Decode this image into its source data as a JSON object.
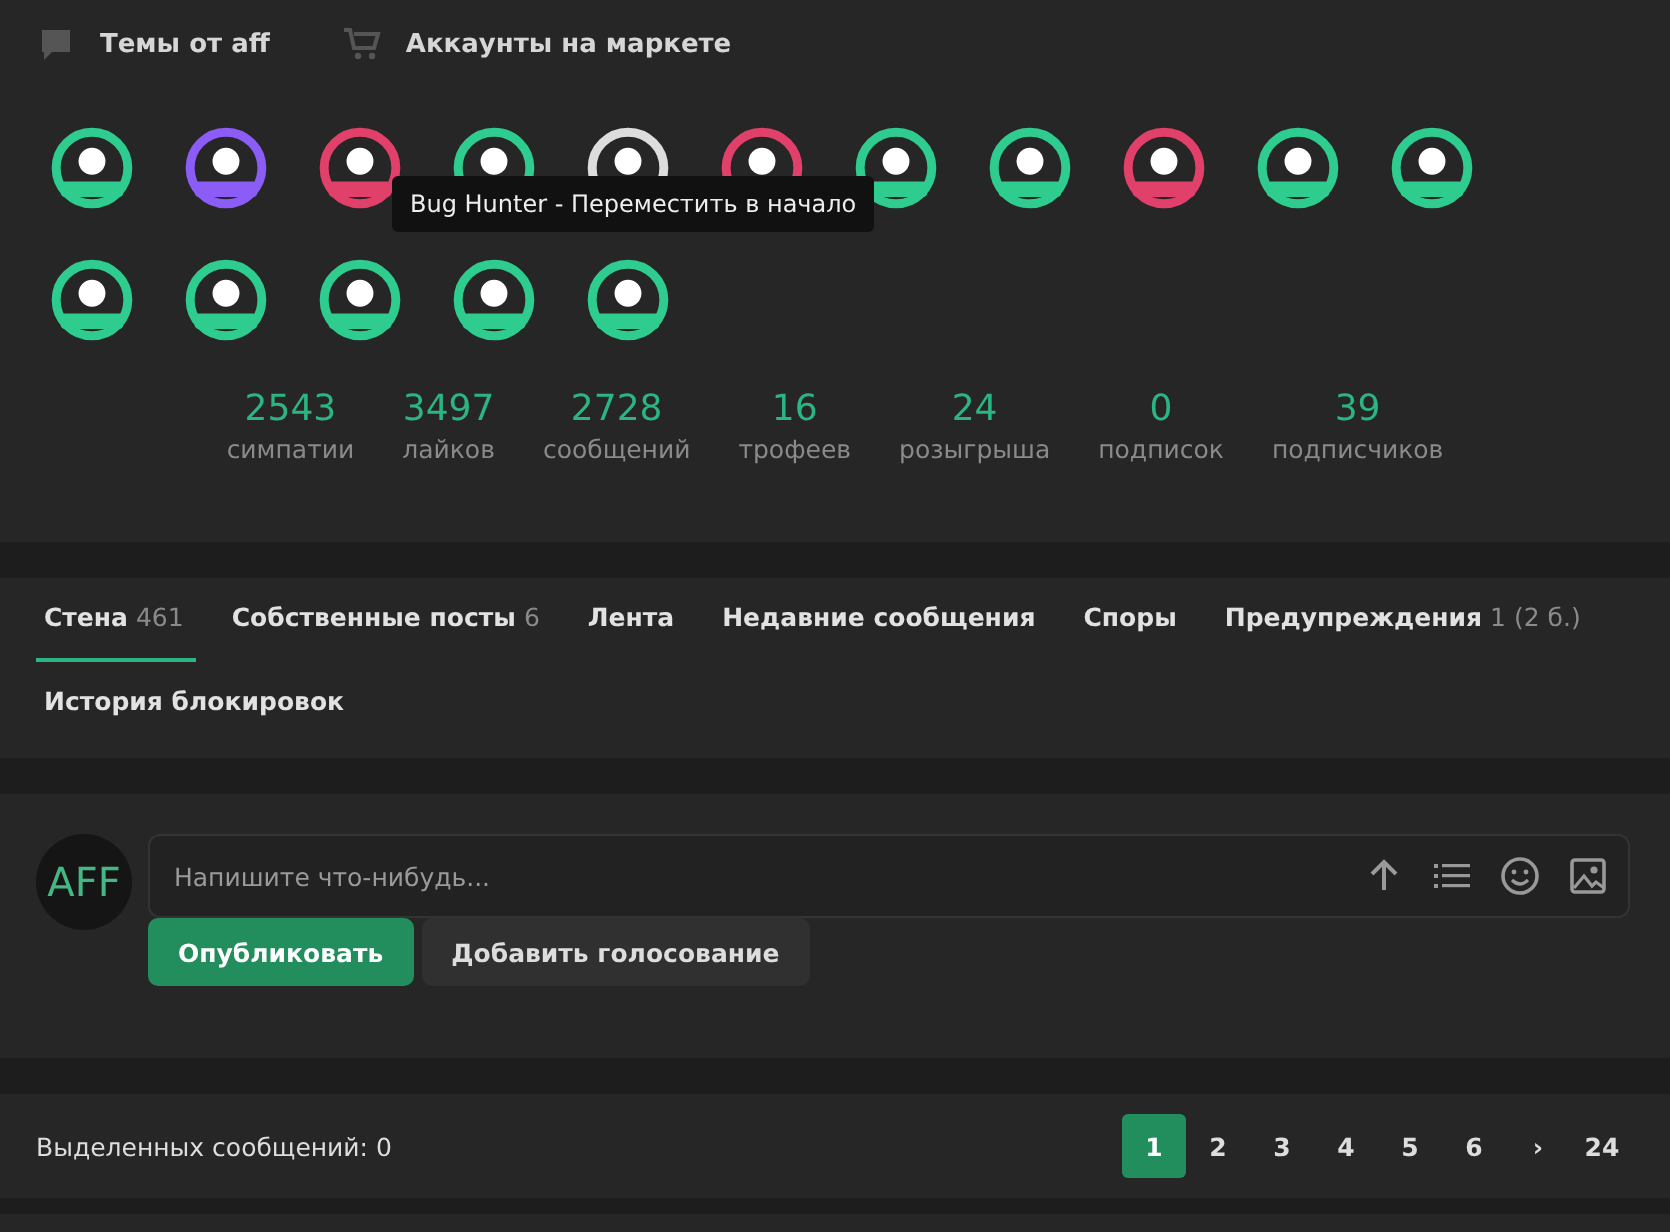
{
  "links": [
    {
      "kind": "chat",
      "label": "Темы от aff"
    },
    {
      "kind": "cart",
      "label": "Аккаунты на маркете"
    }
  ],
  "badges": [
    {
      "color": "#2ecc8f"
    },
    {
      "color": "#8b5cf6"
    },
    {
      "color": "#e0406a"
    },
    {
      "color": "#2ecc8f"
    },
    {
      "color": "#dddddd"
    },
    {
      "color": "#e0406a"
    },
    {
      "color": "#2ecc8f"
    },
    {
      "color": "#2ecc8f"
    },
    {
      "color": "#e0406a"
    },
    {
      "color": "#2ecc8f"
    },
    {
      "color": "#2ecc8f"
    },
    {
      "color": "#2ecc8f"
    },
    {
      "color": "#2ecc8f"
    },
    {
      "color": "#2ecc8f"
    },
    {
      "color": "#2ecc8f"
    },
    {
      "color": "#2ecc8f",
      "tooltip": "Bug Hunter - Переместить в начало"
    }
  ],
  "stats": [
    {
      "value": "2543",
      "label": "симпатии"
    },
    {
      "value": "3497",
      "label": "лайков"
    },
    {
      "value": "2728",
      "label": "сообщений"
    },
    {
      "value": "16",
      "label": "трофеев"
    },
    {
      "value": "24",
      "label": "розыгрыша"
    },
    {
      "value": "0",
      "label": "подписок"
    },
    {
      "value": "39",
      "label": "подписчиков"
    }
  ],
  "tabs": [
    {
      "label": "Стена",
      "count": "461",
      "selected": true
    },
    {
      "label": "Собственные посты",
      "count": "6",
      "selected": false
    },
    {
      "label": "Лента",
      "selected": false
    },
    {
      "label": "Недавние сообщения",
      "selected": false
    },
    {
      "label": "Споры",
      "selected": false
    },
    {
      "label": "Предупреждения",
      "count": "1 (2 б.)",
      "selected": false
    },
    {
      "label": "История блокировок",
      "selected": false
    }
  ],
  "composer": {
    "avatar": "AFF",
    "placeholder": "Напишите что-нибудь...",
    "buttons": [
      {
        "kind": "primary",
        "label": "Опубликовать"
      },
      {
        "kind": "secondary",
        "label": "Добавить голосование"
      }
    ]
  },
  "footer": {
    "selected_text": "Выделенных сообщений: 0",
    "pages": [
      {
        "label": "1",
        "selected": true
      },
      {
        "label": "2",
        "selected": false
      },
      {
        "label": "3",
        "selected": false
      },
      {
        "label": "4",
        "selected": false
      },
      {
        "label": "5",
        "selected": false
      },
      {
        "label": "6",
        "selected": false
      },
      {
        "label": "›",
        "selected": false
      },
      {
        "label": "24",
        "selected": false
      }
    ]
  }
}
